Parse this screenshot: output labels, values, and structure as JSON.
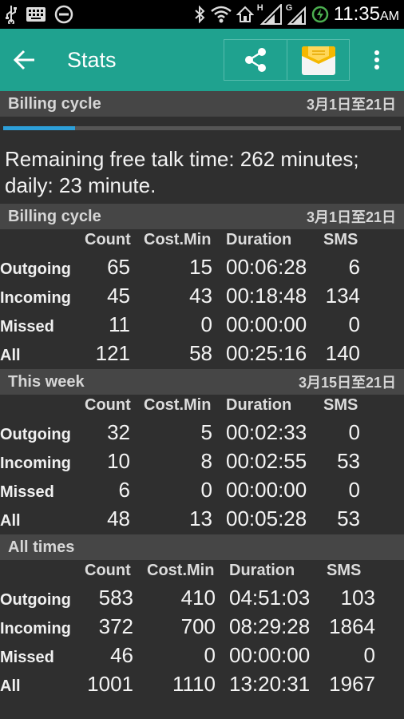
{
  "status_bar": {
    "time": "11:35",
    "ampm": "AM",
    "network_letter_1": "H",
    "network_letter_2": "G",
    "icons": [
      "usb-icon",
      "keyboard-icon",
      "do-not-disturb-icon",
      "bluetooth-icon",
      "wifi-icon",
      "home-icon",
      "signal-icon",
      "signal-icon",
      "data-saver-icon"
    ]
  },
  "app_bar": {
    "title": "Stats",
    "back_icon": "arrow-back-icon",
    "share_icon": "share-icon",
    "message_icon": "envelope-icon",
    "overflow_icon": "more-vert-icon",
    "color": "#1fa28f"
  },
  "billing_top": {
    "title": "Billing cycle",
    "date_range": "3月1日至21日",
    "progress": 0.18
  },
  "remaining_text": "Remaining free talk time: 262 minutes; daily: 23 minute.",
  "tables": [
    {
      "title": "Billing cycle",
      "date_range": "3月1日至21日",
      "headers": [
        "Count",
        "Cost.Min",
        "Duration",
        "SMS"
      ],
      "rows": [
        {
          "label": "Outgoing",
          "count": "65",
          "cost": "15",
          "duration": "00:06:28",
          "sms": "6"
        },
        {
          "label": "Incoming",
          "count": "45",
          "cost": "43",
          "duration": "00:18:48",
          "sms": "134"
        },
        {
          "label": "Missed",
          "count": "11",
          "cost": "0",
          "duration": "00:00:00",
          "sms": "0"
        },
        {
          "label": "All",
          "count": "121",
          "cost": "58",
          "duration": "00:25:16",
          "sms": "140"
        }
      ]
    },
    {
      "title": "This week",
      "date_range": "3月15日至21日",
      "headers": [
        "Count",
        "Cost.Min",
        "Duration",
        "SMS"
      ],
      "rows": [
        {
          "label": "Outgoing",
          "count": "32",
          "cost": "5",
          "duration": "00:02:33",
          "sms": "0"
        },
        {
          "label": "Incoming",
          "count": "10",
          "cost": "8",
          "duration": "00:02:55",
          "sms": "53"
        },
        {
          "label": "Missed",
          "count": "6",
          "cost": "0",
          "duration": "00:00:00",
          "sms": "0"
        },
        {
          "label": "All",
          "count": "48",
          "cost": "13",
          "duration": "00:05:28",
          "sms": "53"
        }
      ]
    },
    {
      "title": "All times",
      "date_range": "",
      "headers": [
        "Count",
        "Cost.Min",
        "Duration",
        "SMS"
      ],
      "rows": [
        {
          "label": "Outgoing",
          "count": "583",
          "cost": "410",
          "duration": "04:51:03",
          "sms": "103"
        },
        {
          "label": "Incoming",
          "count": "372",
          "cost": "700",
          "duration": "08:29:28",
          "sms": "1864"
        },
        {
          "label": "Missed",
          "count": "46",
          "cost": "0",
          "duration": "00:00:00",
          "sms": "0"
        },
        {
          "label": "All",
          "count": "1001",
          "cost": "1110",
          "duration": "13:20:31",
          "sms": "1967"
        }
      ]
    }
  ]
}
